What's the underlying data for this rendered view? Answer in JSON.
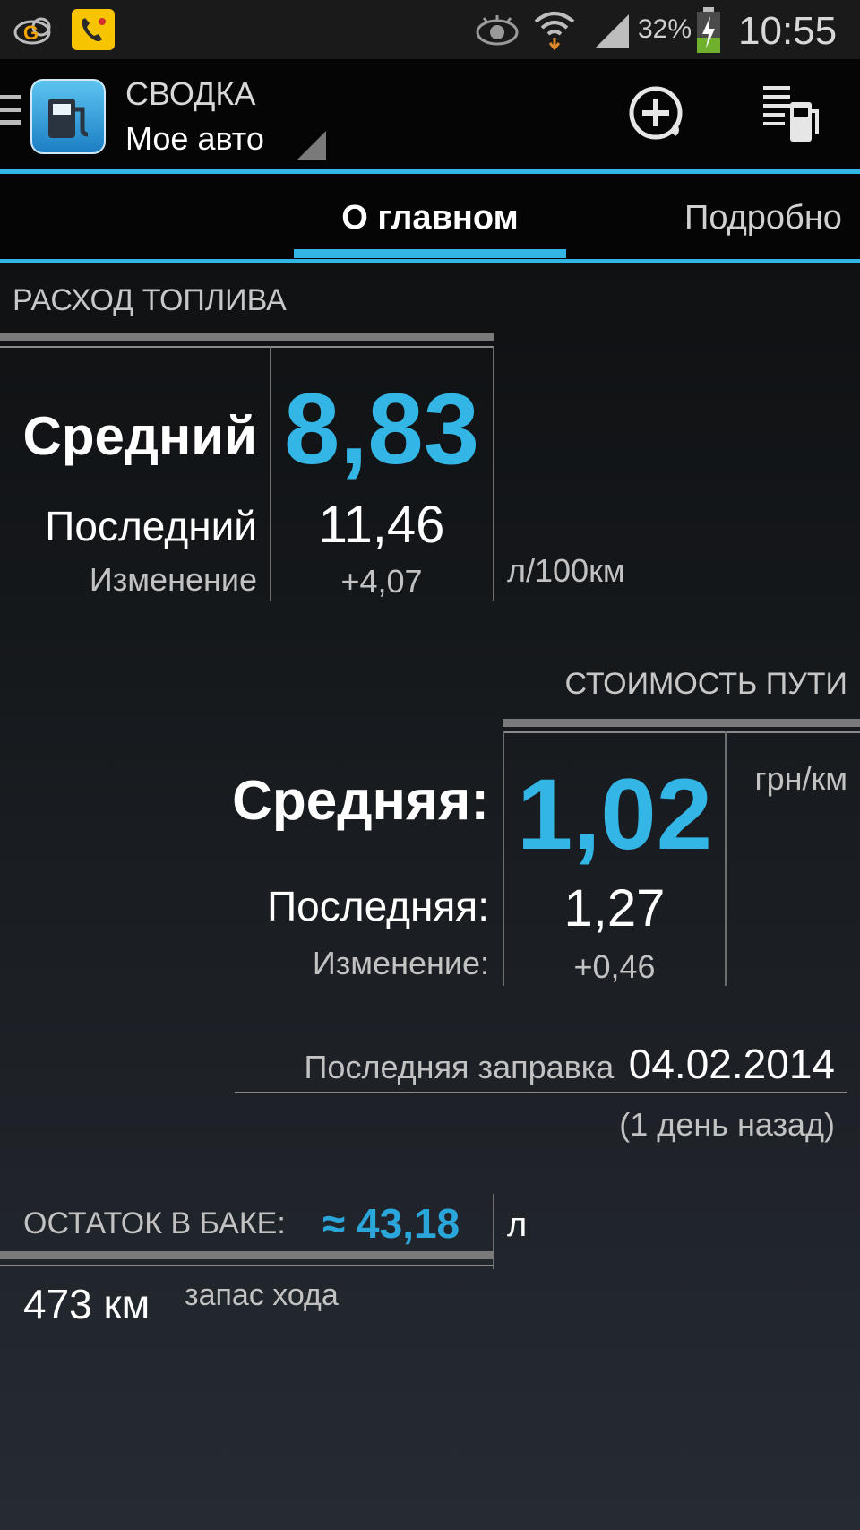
{
  "status_bar": {
    "battery": "32%",
    "time": "10:55",
    "icons": [
      "cloud-g-icon",
      "phone-app-icon",
      "eye-icon",
      "wifi-icon",
      "signal-icon",
      "battery-charging-icon"
    ]
  },
  "action_bar": {
    "title": "СВОДКА",
    "subtitle": "Мое авто",
    "icons": [
      "menu-icon",
      "app-fuel-icon",
      "add-refuel-icon",
      "refuel-list-icon"
    ]
  },
  "tabs": [
    {
      "label": "О главном",
      "active": true
    },
    {
      "label": "Подробно",
      "active": false
    }
  ],
  "fuel": {
    "title": "РАСХОД ТОПЛИВА",
    "avg_label": "Средний",
    "avg_value": "8,83",
    "last_label": "Последний",
    "last_value": "11,46",
    "change_label": "Изменение",
    "change_value": "+4,07",
    "unit": "л/100км"
  },
  "cost": {
    "title": "СТОИМОСТЬ ПУТИ",
    "avg_label": "Средняя:",
    "avg_value": "1,02",
    "last_label": "Последняя:",
    "last_value": "1,27",
    "change_label": "Изменение:",
    "change_value": "+0,46",
    "unit": "грн/км"
  },
  "refuel": {
    "label": "Последняя заправка",
    "date": "04.02.2014",
    "ago": "(1 день назад)"
  },
  "tank": {
    "label": "ОСТАТОК В БАКЕ:",
    "value": "≈ 43,18",
    "unit": "л",
    "range_value": "473 км",
    "range_label": "запас хода"
  },
  "colors": {
    "accent": "#33b5e5",
    "background": "#15181b"
  }
}
